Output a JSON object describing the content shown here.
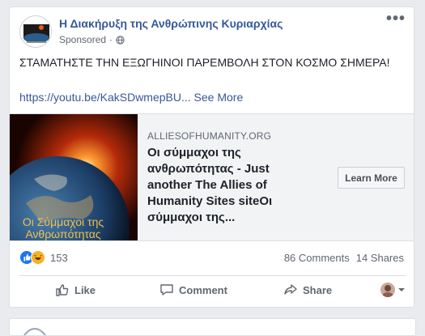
{
  "post": {
    "page_name": "Η Διακήρυξη της Ανθρώπινης Κυριαρχίας",
    "sponsored_label": "Sponsored",
    "dot": "·",
    "more_label": "•••",
    "text": "ΣΤΑΜΑΤΗΣΤΕ ΤΗΝ ΕΞΩΓΗΙΝΟΙ ΠΑΡΕΜΒΟΛΗ ΣΤΟΝ ΚΟΣΜΟ ΣΗΜΕΡΑ!",
    "link_text": "https://youtu.be/KakSDwmepBU...",
    "see_more": "See More"
  },
  "link_card": {
    "thumb_caption": "Οι Σύμμαχοι της Ανθρωπότητας",
    "domain": "ALLIESOFHUMANITY.ORG",
    "headline": "Οι σύμμαχοι της ανθρωπότητας - Just another The Allies of Humanity Sites siteΟι σύμμαχοι της...",
    "cta": "Learn More"
  },
  "stats": {
    "reaction_count": "153",
    "comments": "86 Comments",
    "shares": "14 Shares"
  },
  "actions": {
    "like": "Like",
    "comment": "Comment",
    "share": "Share"
  },
  "icons": [
    "globe-icon",
    "like-reaction-icon",
    "haha-reaction-icon",
    "like-icon",
    "comment-icon",
    "share-icon",
    "chevron-down-icon"
  ],
  "colors": {
    "link": "#385898",
    "like_blue": "#1877f2",
    "haha_yellow": "#f7b125",
    "background": "#e9ebee"
  }
}
